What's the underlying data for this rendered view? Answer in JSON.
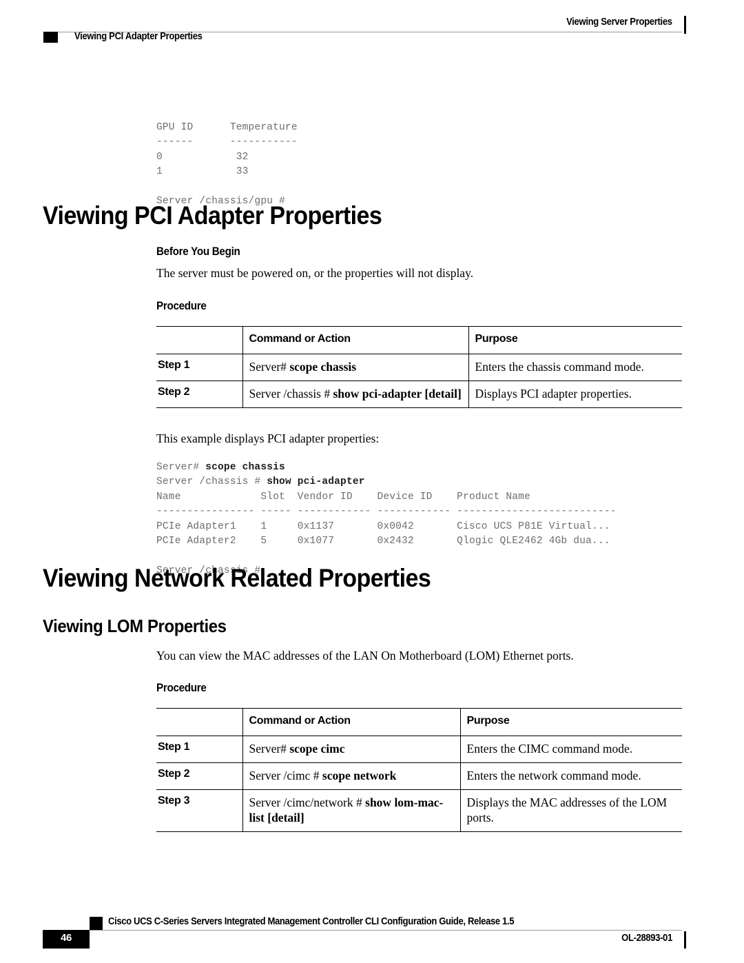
{
  "header": {
    "running_head_right": "Viewing Server Properties",
    "running_head_left": "Viewing PCI Adapter Properties"
  },
  "gpu_code_block": {
    "lines": [
      "GPU ID      Temperature",
      "------      -----------",
      "0            32",
      "1            33",
      "",
      "Server /chassis/gpu #"
    ],
    "text": "GPU ID      Temperature\n------      -----------\n0            32\n1            33\n\nServer /chassis/gpu #"
  },
  "section_pci": {
    "heading": "Viewing PCI Adapter Properties",
    "before_you_begin_heading": "Before You Begin",
    "before_you_begin_text": "The server must be powered on, or the properties will not display.",
    "procedure_heading": "Procedure",
    "table": {
      "columns": [
        "",
        "Command or Action",
        "Purpose"
      ],
      "rows": [
        {
          "step": "Step 1",
          "command_plain": "Server# ",
          "command_bold": "scope chassis",
          "command_bold2": "",
          "purpose": "Enters the chassis command mode."
        },
        {
          "step": "Step 2",
          "command_plain": "Server /chassis # ",
          "command_bold": "show pci-adapter [detail]",
          "command_bold2": "",
          "purpose": "Displays PCI adapter properties."
        }
      ]
    },
    "example_intro": "This example displays PCI adapter properties:",
    "example_code": {
      "line1_plain": "Server# ",
      "line1_bold": "scope chassis",
      "line2_plain": "Server /chassis # ",
      "line2_bold": "show pci-adapter",
      "rest": "Name             Slot  Vendor ID    Device ID    Product Name\n---------------- ----- ------------ ------------ --------------------------\nPCIe Adapter1    1     0x1137       0x0042       Cisco UCS P81E Virtual...\nPCIe Adapter2    5     0x1077       0x2432       Qlogic QLE2462 4Gb dua...\n\nServer /chassis #"
    }
  },
  "section_network": {
    "heading": "Viewing Network Related Properties"
  },
  "section_lom": {
    "heading": "Viewing LOM Properties",
    "intro_text": "You can view the MAC addresses of the LAN On Motherboard (LOM) Ethernet ports.",
    "procedure_heading": "Procedure",
    "table": {
      "columns": [
        "",
        "Command or Action",
        "Purpose"
      ],
      "rows": [
        {
          "step": "Step 1",
          "command_plain": "Server# ",
          "command_bold": "scope cimc",
          "purpose": "Enters the CIMC command mode."
        },
        {
          "step": "Step 2",
          "command_plain": "Server /cimc # ",
          "command_bold": "scope network",
          "purpose": "Enters the network command mode."
        },
        {
          "step": "Step 3",
          "command_plain": "Server /cimc/network # ",
          "command_bold": "show lom-mac-list [detail]",
          "purpose": "Displays the MAC addresses of the LOM ports."
        }
      ]
    }
  },
  "footer": {
    "page_number": "46",
    "guide_title": "Cisco UCS C-Series Servers Integrated Management Controller CLI Configuration Guide, Release 1.5",
    "doc_id": "OL-28893-01"
  }
}
